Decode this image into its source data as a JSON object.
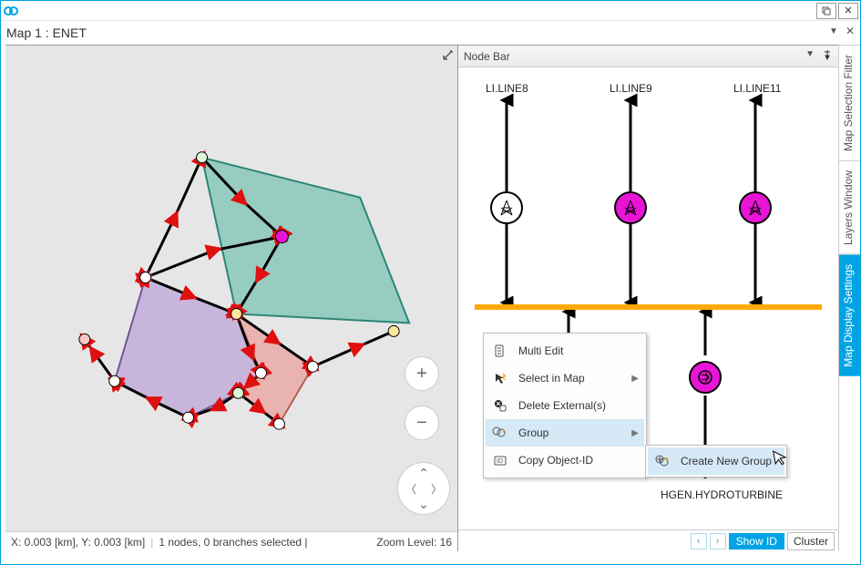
{
  "titlebar": {
    "app_label": ""
  },
  "tab": {
    "title": "Map 1 : ENET"
  },
  "map_status": {
    "coords": "X: 0.003 [km], Y: 0.003 [km]",
    "selection": "1 nodes, 0 branches selected  |",
    "zoom_label": "Zoom Level: 16"
  },
  "nodebar": {
    "title": "Node Bar",
    "lines": {
      "l1": "LI.LINE8",
      "l2": "LI.LINE9",
      "l3": "LI.LINE11"
    },
    "generator_label": "HGEN.HYDROTURBINE"
  },
  "footer": {
    "show_id": "Show ID",
    "cluster": "Cluster"
  },
  "context_menu": {
    "multi_edit": "Multi Edit",
    "select_in_map": "Select in Map",
    "delete_ext": "Delete External(s)",
    "group": "Group",
    "copy_id": "Copy Object-ID",
    "submenu": {
      "create_group": "Create New Group"
    }
  },
  "side_tabs": {
    "filter": "Map Selection Filter",
    "layers": "Layers Window",
    "display": "Map Display Settings"
  }
}
